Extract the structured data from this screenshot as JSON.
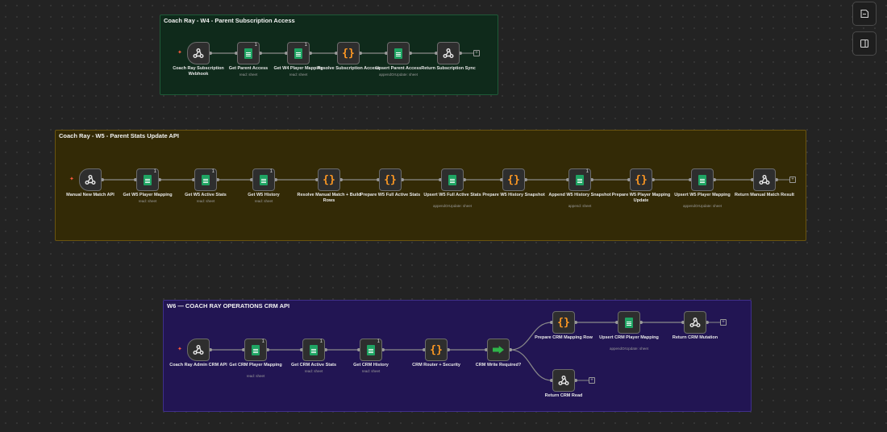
{
  "toolbar": {
    "buttons": [
      {
        "name": "sticky-note-button",
        "icon": "sticky-note-icon"
      },
      {
        "name": "toggle-panel-button",
        "icon": "panel-right-icon"
      }
    ]
  },
  "workflows": [
    {
      "title": "Coach Ray - W4 - Parent Subscription Access",
      "nodes": [
        {
          "label": "Coach Ray Subscription Webhook",
          "type": "webhook",
          "sub": ""
        },
        {
          "label": "Get Parent Access",
          "type": "sheets",
          "sub": "read: sheet",
          "badge": "1"
        },
        {
          "label": "Get W4 Player Mapping",
          "type": "sheets",
          "sub": "read: sheet",
          "badge": "1"
        },
        {
          "label": "Resolve Subscription Access",
          "type": "code",
          "sub": ""
        },
        {
          "label": "Upsert Parent Access",
          "type": "sheets",
          "sub": "appendOrUpdate: sheet"
        },
        {
          "label": "Return Subscription Sync",
          "type": "webhook",
          "sub": ""
        }
      ]
    },
    {
      "title": "Coach Ray - W5 - Parent Stats Update API",
      "nodes": [
        {
          "label": "Manual New Match API",
          "type": "webhook",
          "sub": ""
        },
        {
          "label": "Get W5 Player Mapping",
          "type": "sheets",
          "sub": "read: sheet",
          "badge": "1"
        },
        {
          "label": "Get W5 Active Stats",
          "type": "sheets",
          "sub": "read: sheet",
          "badge": "1"
        },
        {
          "label": "Get W5 History",
          "type": "sheets",
          "sub": "read: sheet",
          "badge": "1"
        },
        {
          "label": "Resolve Manual Match + Build Rows",
          "type": "code",
          "sub": ""
        },
        {
          "label": "Prepare W5 Full Active Stats",
          "type": "code",
          "sub": ""
        },
        {
          "label": "Upsert W5 Full Active Stats",
          "type": "sheets",
          "sub": "appendOrUpdate: sheet"
        },
        {
          "label": "Prepare W5 History Snapshot",
          "type": "code",
          "sub": ""
        },
        {
          "label": "Append W5 History Snapshot",
          "type": "sheets",
          "sub": "append: sheet",
          "badge": "1"
        },
        {
          "label": "Prepare W5 Player Mapping Update",
          "type": "code",
          "sub": ""
        },
        {
          "label": "Upsert W5 Player Mapping",
          "type": "sheets",
          "sub": "appendOrUpdate: sheet"
        },
        {
          "label": "Return Manual Match Result",
          "type": "webhook",
          "sub": ""
        }
      ]
    },
    {
      "title": "W6 — COACH RAY OPERATIONS CRM API",
      "nodes": [
        {
          "label": "Coach Ray Admin CRM API",
          "type": "webhook",
          "sub": ""
        },
        {
          "label": "Get CRM Player Mapping",
          "type": "sheets",
          "sub": "read: sheet",
          "badge": "1"
        },
        {
          "label": "Get CRM Active Stats",
          "type": "sheets",
          "sub": "read: sheet",
          "badge": "1"
        },
        {
          "label": "Get CRM History",
          "type": "sheets",
          "sub": "read: sheet",
          "badge": "1"
        },
        {
          "label": "CRM Router + Security",
          "type": "code",
          "sub": ""
        },
        {
          "label": "CRM Write Required?",
          "type": "if",
          "sub": ""
        },
        {
          "label": "Prepare CRM Mapping Row",
          "type": "code",
          "sub": ""
        },
        {
          "label": "Upsert CRM Player Mapping",
          "type": "sheets",
          "sub": "appendOrUpdate: sheet"
        },
        {
          "label": "Return CRM Mutation",
          "type": "webhook",
          "sub": ""
        },
        {
          "label": "Return CRM Read",
          "type": "webhook",
          "sub": ""
        }
      ]
    }
  ],
  "colors": {
    "sticky_green": "#0f2a1b",
    "sticky_yellow": "#332a06",
    "sticky_purple": "#221553",
    "sheets_green": "#1fa463",
    "code_orange": "#ff9922"
  }
}
